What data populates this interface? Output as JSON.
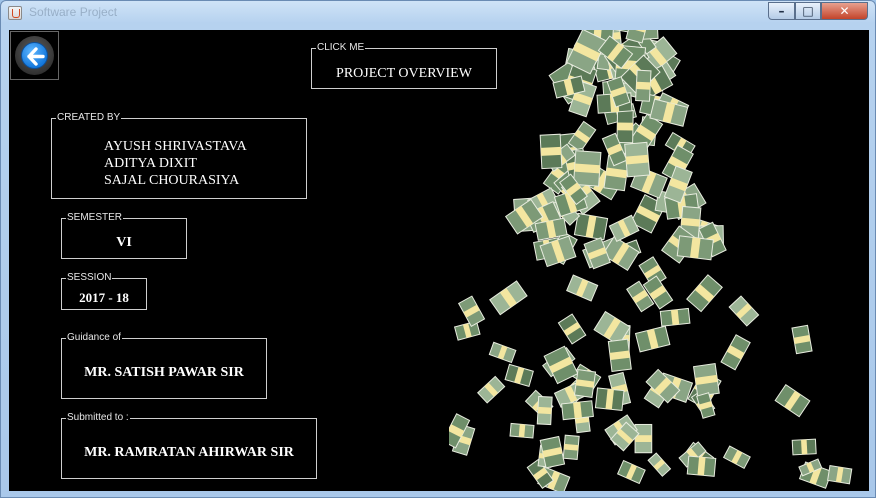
{
  "window": {
    "title": "Software Project",
    "minimize_label": "–",
    "maximize_label": "□",
    "close_label": "✕"
  },
  "nav": {
    "back_icon": "back-arrow-icon"
  },
  "overview": {
    "legend": "CLICK ME",
    "button_label": "PROJECT OVERVIEW"
  },
  "created_by": {
    "legend": "CREATED BY",
    "names": [
      "AYUSH SHRIVASTAVA",
      "ADITYA DIXIT",
      "SAJAL CHOURASIYA"
    ]
  },
  "semester": {
    "legend": "SEMESTER",
    "value": "VI"
  },
  "session": {
    "legend": "SESSION",
    "value": "2017 - 18"
  },
  "guidance": {
    "legend": "Guidance of",
    "value": "MR. SATISH PAWAR SIR"
  },
  "submitted": {
    "legend": "Submitted to :",
    "value": "MR. RAMRATAN AHIRWAR SIR"
  },
  "theme": {
    "background": "#000000",
    "accent": "#1478dc",
    "text": "#ffffff"
  }
}
